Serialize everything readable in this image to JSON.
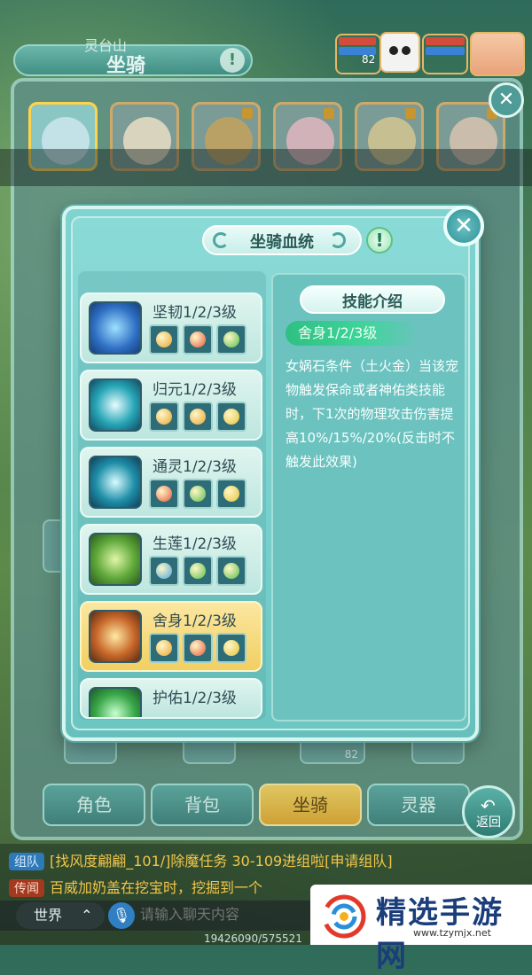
{
  "header": {
    "map_name": "灵台山",
    "panel_title": "坐骑",
    "info_icon": "!",
    "team_level": "82"
  },
  "modal": {
    "title": "坐骑血统",
    "info_icon": "!",
    "close_icon": "✕",
    "skills": [
      {
        "name": "坚韧1/2/3级",
        "icon": "tough-skill-icon",
        "color": "#2f6fc4",
        "gems": [
          "#e8a531",
          "#e35b3d",
          "#5bbf4a"
        ]
      },
      {
        "name": "归元1/2/3级",
        "icon": "return-origin-skill-icon",
        "color": "#27a6b6",
        "gems": [
          "#e8a531",
          "#e8a531",
          "#e3c43a"
        ]
      },
      {
        "name": "通灵1/2/3级",
        "icon": "spirit-skill-icon",
        "color": "#1f8fa8",
        "gems": [
          "#e35b3d",
          "#5bbf4a",
          "#e3c43a"
        ]
      },
      {
        "name": "生莲1/2/3级",
        "icon": "lotus-skill-icon",
        "color": "#5fa83a",
        "gems": [
          "#4aa8e0",
          "#5bbf4a",
          "#5bbf4a"
        ]
      },
      {
        "name": "舍身1/2/3级",
        "icon": "sacrifice-skill-icon",
        "color": "#c7672a",
        "gems": [
          "#e8a531",
          "#e35b3d",
          "#e3c43a"
        ]
      },
      {
        "name": "护佑1/2/3级",
        "icon": "protect-skill-icon",
        "color": "#3aa84a",
        "gems": [
          "#e8a531",
          "#e8a531",
          "#e3c43a"
        ]
      }
    ],
    "detail": {
      "title": "技能介绍",
      "skill_name": "舍身1/2/3级",
      "description": "女娲石条件（土火金）当该宠物触发保命或者神佑类技能时，下1次的物理攻击伤害提高10%/15%/20%(反击时不触发此效果)"
    }
  },
  "bottom_tabs": [
    {
      "label": "角色"
    },
    {
      "label": "背包"
    },
    {
      "label": "坐骑"
    },
    {
      "label": "灵器"
    }
  ],
  "return_label": "返回",
  "back_panel_level": "82",
  "chat": {
    "lines": [
      {
        "tag": "组队",
        "text": "[找风度翩翩_101/]除魔任务 30-109进组啦[申请组队]"
      },
      {
        "tag": "传闻",
        "text": "百威加奶盖在挖宝时，挖掘到一个"
      }
    ],
    "channel": "世界",
    "placeholder": "请输入聊天内容",
    "coords": "19426090/575521"
  },
  "watermark": {
    "text": "精选手游网",
    "url": "www.tzymjx.net"
  }
}
